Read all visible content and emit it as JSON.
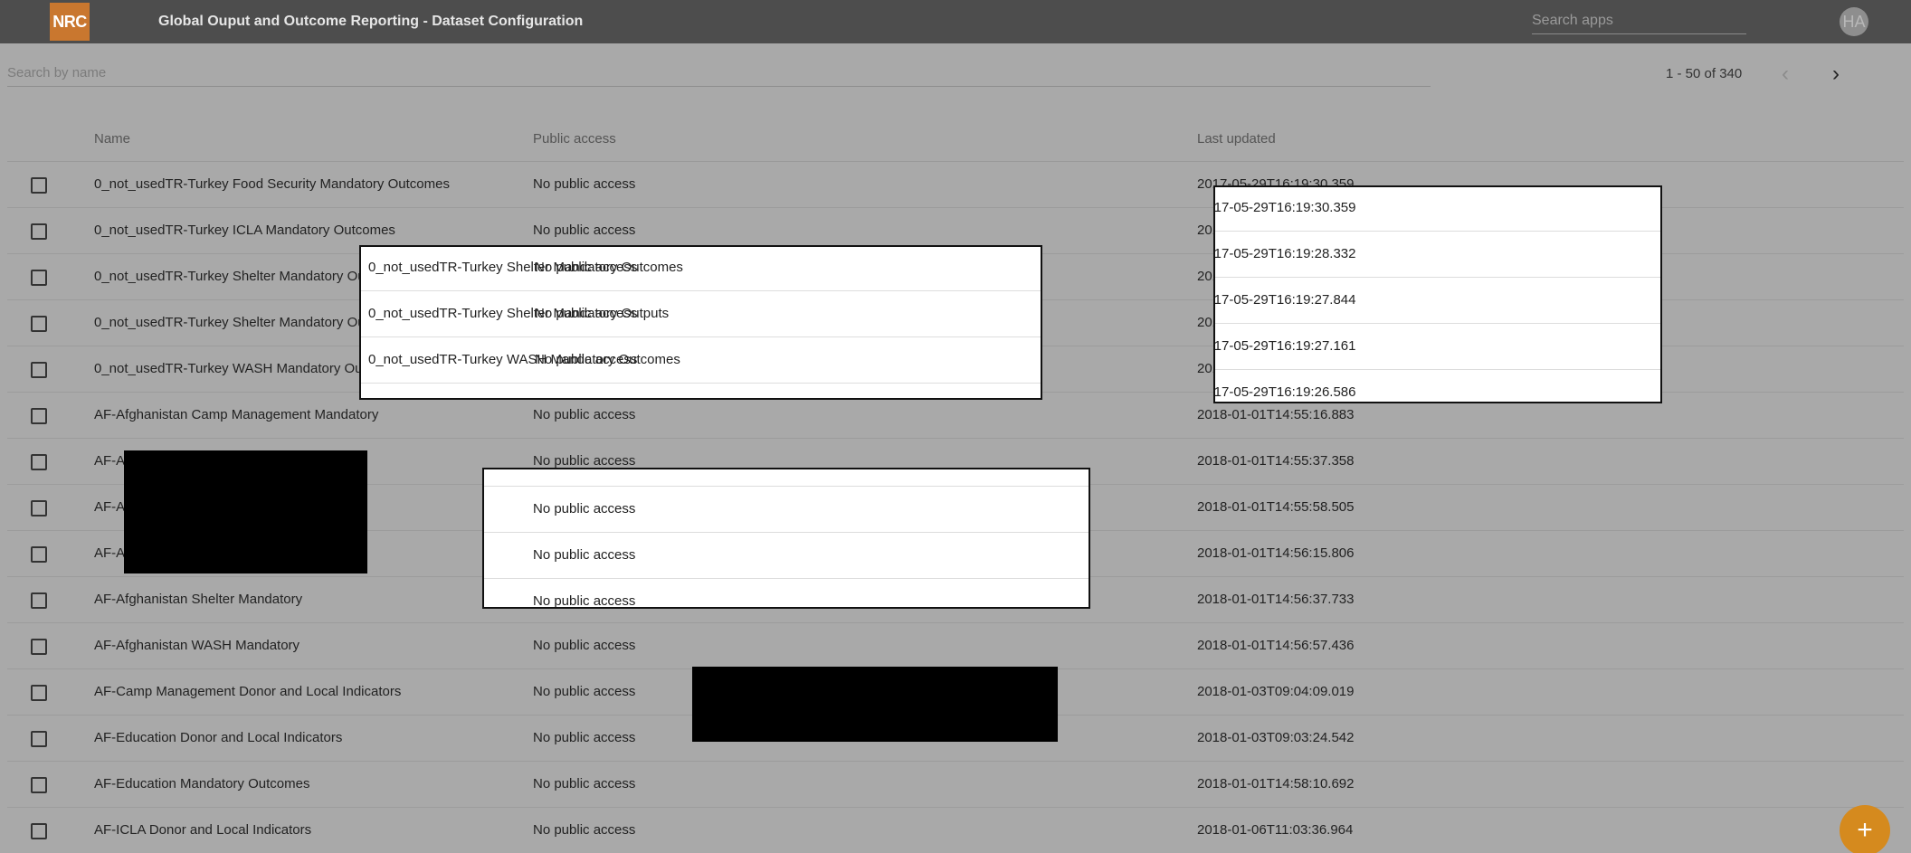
{
  "app": {
    "logo_text": "NRC",
    "title": "Global Ouput and Outcome Reporting - Dataset Configuration",
    "search_apps_placeholder": "Search apps",
    "user_initials": "HA"
  },
  "filter": {
    "search_placeholder": "Search by name"
  },
  "pagination": {
    "range_text": "1 - 50 of 340",
    "prev_icon": "chevron-left-icon",
    "next_icon": "chevron-right-icon"
  },
  "table": {
    "columns": [
      "Name",
      "Public access",
      "Last updated"
    ],
    "rows": [
      {
        "name": "0_not_usedTR-Turkey Food Security Mandatory Outcomes",
        "access": "No public access",
        "updated": "2017-05-29T16:19:30.359"
      },
      {
        "name": "0_not_usedTR-Turkey ICLA Mandatory Outcomes",
        "access": "No public access",
        "updated": "2017-05-29T16:19:28.332"
      },
      {
        "name": "0_not_usedTR-Turkey Shelter Mandatory Outcomes",
        "access": "No public access",
        "updated": "2017-05-29T16:19:27.844"
      },
      {
        "name": "0_not_usedTR-Turkey Shelter Mandatory Outputs",
        "access": "No public access",
        "updated": "2017-05-29T16:19:27.161"
      },
      {
        "name": "0_not_usedTR-Turkey WASH Mandatory Outcomes",
        "access": "No public access",
        "updated": "2017-05-29T16:19:26.586"
      },
      {
        "name": "AF-Afghanistan Camp Management Mandatory",
        "access": "No public access",
        "updated": "2018-01-01T14:55:16.883"
      },
      {
        "name": "AF-A",
        "access": "No public access",
        "updated": "2018-01-01T14:55:37.358"
      },
      {
        "name": "AF-A",
        "access": "No public access",
        "updated": "2018-01-01T14:55:58.505"
      },
      {
        "name": "AF-A",
        "access": "No public access",
        "updated": "2018-01-01T14:56:15.806"
      },
      {
        "name": "AF-Afghanistan Shelter Mandatory",
        "access": "No public access",
        "updated": "2018-01-01T14:56:37.733"
      },
      {
        "name": "AF-Afghanistan WASH Mandatory",
        "access": "No public access",
        "updated": "2018-01-01T14:56:57.436"
      },
      {
        "name": "AF-Camp Management Donor and Local Indicators",
        "access": "No public access",
        "updated": "2018-01-03T09:04:09.019"
      },
      {
        "name": "AF-Education Donor and Local Indicators",
        "access": "No public access",
        "updated": "2018-01-03T09:03:24.542"
      },
      {
        "name": "AF-Education Mandatory Outcomes",
        "access": "No public access",
        "updated": "2018-01-01T14:58:10.692"
      },
      {
        "name": "AF-ICLA Donor and Local Indicators",
        "access": "No public access",
        "updated": "2018-01-06T11:03:36.964"
      }
    ]
  },
  "fab": {
    "label": "+",
    "icon": "add-icon"
  },
  "colors": {
    "topbar": "#4d4d4d",
    "logo": "#c9772f",
    "fab": "#d58a1e",
    "dimmed_background": "#a9a9a9"
  }
}
